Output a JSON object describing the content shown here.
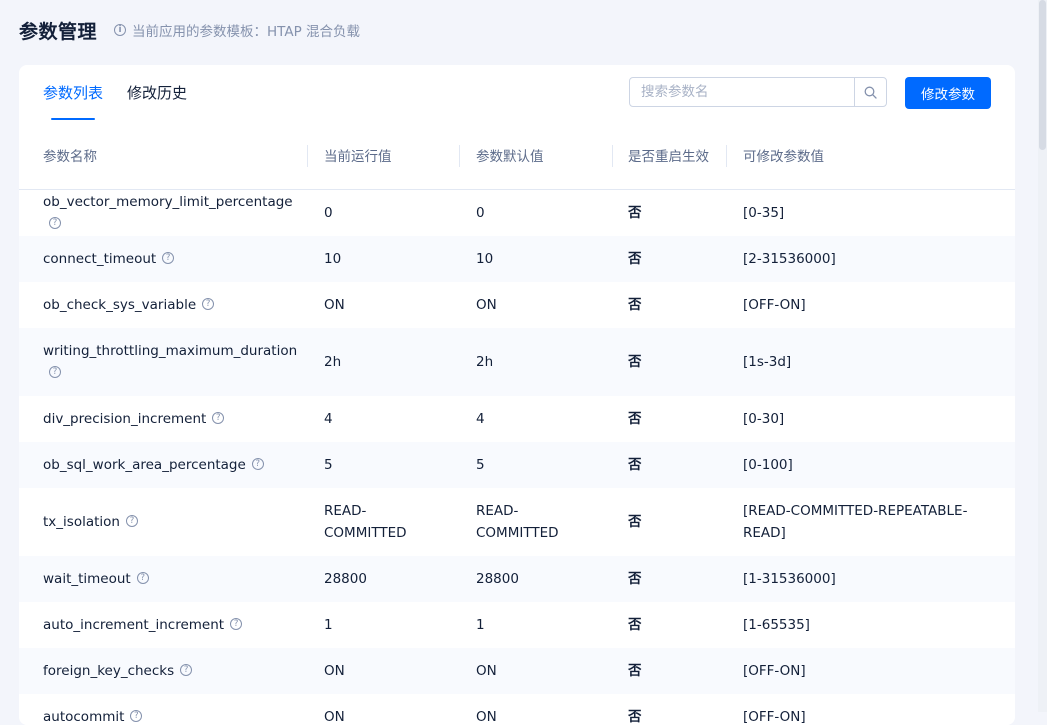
{
  "header": {
    "title": "参数管理",
    "template_note": "当前应用的参数模板：HTAP 混合负载"
  },
  "tabs": [
    {
      "label": "参数列表"
    },
    {
      "label": "修改历史"
    }
  ],
  "search": {
    "placeholder": "搜索参数名",
    "value": ""
  },
  "actions": {
    "modify_label": "修改参数"
  },
  "table": {
    "columns": [
      "参数名称",
      "当前运行值",
      "参数默认值",
      "是否重启生效",
      "可修改参数值"
    ],
    "rows": [
      {
        "name": "ob_vector_memory_limit_percentage",
        "current": "0",
        "default": "0",
        "restart": "否",
        "range": "[0-35]"
      },
      {
        "name": "connect_timeout",
        "current": "10",
        "default": "10",
        "restart": "否",
        "range": "[2-31536000]"
      },
      {
        "name": "ob_check_sys_variable",
        "current": "ON",
        "default": "ON",
        "restart": "否",
        "range": "[OFF-ON]"
      },
      {
        "name": "writing_throttling_maximum_duration",
        "current": "2h",
        "default": "2h",
        "restart": "否",
        "range": "[1s-3d]"
      },
      {
        "name": "div_precision_increment",
        "current": "4",
        "default": "4",
        "restart": "否",
        "range": "[0-30]"
      },
      {
        "name": "ob_sql_work_area_percentage",
        "current": "5",
        "default": "5",
        "restart": "否",
        "range": "[0-100]"
      },
      {
        "name": "tx_isolation",
        "current": "READ-COMMITTED",
        "default": "READ-COMMITTED",
        "restart": "否",
        "range": "[READ-COMMITTED-REPEATABLE-READ]"
      },
      {
        "name": "wait_timeout",
        "current": "28800",
        "default": "28800",
        "restart": "否",
        "range": "[1-31536000]"
      },
      {
        "name": "auto_increment_increment",
        "current": "1",
        "default": "1",
        "restart": "否",
        "range": "[1-65535]"
      },
      {
        "name": "foreign_key_checks",
        "current": "ON",
        "default": "ON",
        "restart": "否",
        "range": "[OFF-ON]"
      },
      {
        "name": "autocommit",
        "current": "ON",
        "default": "ON",
        "restart": "否",
        "range": "[OFF-ON]"
      }
    ]
  },
  "icons": {
    "info": "info-icon",
    "help": "question-circle-icon",
    "search": "search-icon"
  },
  "colors": {
    "accent": "#006aff",
    "text": "#132039",
    "muted": "#5c6b8a",
    "background": "#f3f5fb"
  }
}
